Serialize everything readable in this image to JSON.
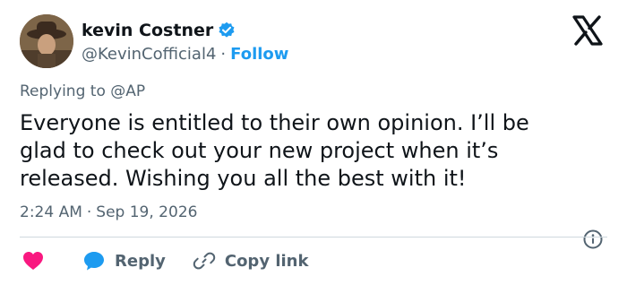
{
  "author": {
    "display_name": "kevin Costner",
    "handle": "@KevinCofficial4",
    "separator": "·",
    "follow_label": "Follow",
    "verified": true
  },
  "reply_context": {
    "prefix": "Replying to",
    "mention": "@AP"
  },
  "tweet": {
    "text": "Everyone is entitled to their own opinion. I’ll be\nglad to check out your new project when it’s\nreleased. Wishing you all the best with it!",
    "time": "2:24 AM",
    "date_separator": "·",
    "date": "Sep 19, 2026"
  },
  "actions": {
    "like_label": "",
    "reply_label": "Reply",
    "copy_link_label": "Copy link"
  },
  "colors": {
    "accent": "#1d9bf0",
    "like": "#f91880",
    "text_primary": "#0f1419",
    "text_secondary": "#536471",
    "divider": "#cfd9de"
  },
  "icons": [
    "verified-badge-icon",
    "x-logo-icon",
    "info-icon",
    "heart-icon",
    "reply-bubble-icon",
    "link-icon"
  ]
}
